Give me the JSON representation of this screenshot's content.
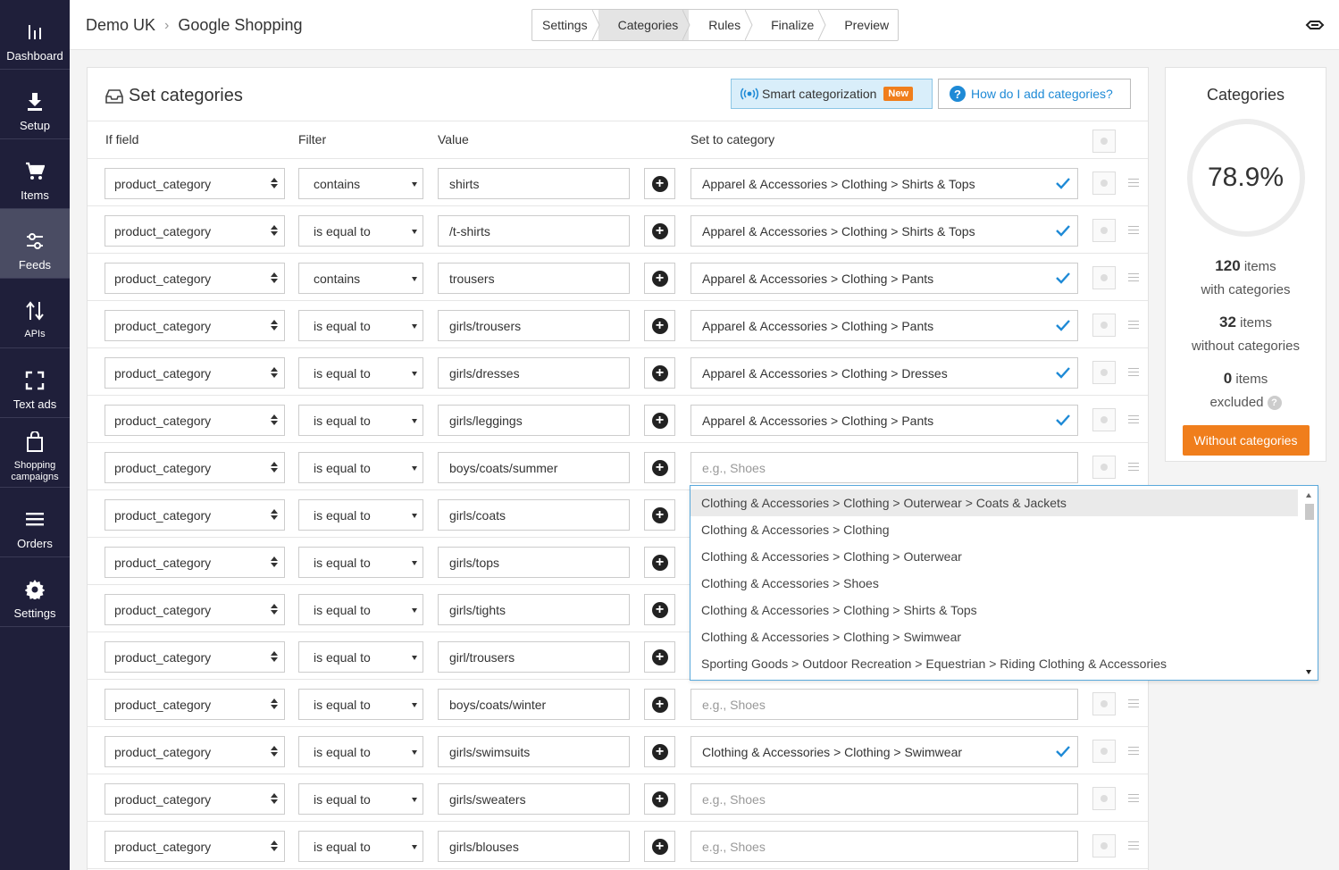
{
  "sidebar": {
    "items": [
      {
        "label": "Dashboard",
        "icon": "chart-bars-icon"
      },
      {
        "label": "Setup",
        "icon": "download-icon"
      },
      {
        "label": "Items",
        "icon": "cart-icon"
      },
      {
        "label": "Feeds",
        "icon": "sliders-icon",
        "active": true
      },
      {
        "label": "APIs",
        "icon": "swap-vertical-icon"
      },
      {
        "label": "Text ads",
        "icon": "frame-corners-icon"
      },
      {
        "label": "Shopping campaigns",
        "icon": "shopping-bag-icon"
      },
      {
        "label": "Orders",
        "icon": "list-lines-icon"
      },
      {
        "label": "Settings",
        "icon": "gear-icon"
      }
    ]
  },
  "header": {
    "breadcrumb": [
      "Demo UK",
      "Google Shopping"
    ],
    "steps": [
      {
        "label": "Settings"
      },
      {
        "label": "Categories",
        "active": true
      },
      {
        "label": "Rules"
      },
      {
        "label": "Finalize"
      },
      {
        "label": "Preview"
      }
    ]
  },
  "panel": {
    "title": "Set categories",
    "smart_label": "Smart categorization",
    "new_badge": "New",
    "help_label": "How do I add categories?",
    "columns": {
      "if_field": "If field",
      "filter": "Filter",
      "value": "Value",
      "set_to_category": "Set to category"
    },
    "placeholder": "e.g., Shoes",
    "rows": [
      {
        "field": "product_category",
        "filter": "contains",
        "value": "shirts",
        "category": "Apparel & Accessories > Clothing > Shirts & Tops"
      },
      {
        "field": "product_category",
        "filter": "is equal to",
        "value": "/t-shirts",
        "category": "Apparel & Accessories > Clothing > Shirts & Tops"
      },
      {
        "field": "product_category",
        "filter": "contains",
        "value": "trousers",
        "category": "Apparel & Accessories > Clothing > Pants"
      },
      {
        "field": "product_category",
        "filter": "is equal to",
        "value": "girls/trousers",
        "category": "Apparel & Accessories > Clothing > Pants"
      },
      {
        "field": "product_category",
        "filter": "is equal to",
        "value": "girls/dresses",
        "category": "Apparel & Accessories > Clothing > Dresses"
      },
      {
        "field": "product_category",
        "filter": "is equal to",
        "value": "girls/leggings",
        "category": "Apparel & Accessories > Clothing > Pants"
      },
      {
        "field": "product_category",
        "filter": "is equal to",
        "value": "boys/coats/summer",
        "category": ""
      },
      {
        "field": "product_category",
        "filter": "is equal to",
        "value": "girls/coats",
        "category": ""
      },
      {
        "field": "product_category",
        "filter": "is equal to",
        "value": "girls/tops",
        "category": ""
      },
      {
        "field": "product_category",
        "filter": "is equal to",
        "value": "girls/tights",
        "category": ""
      },
      {
        "field": "product_category",
        "filter": "is equal to",
        "value": "girl/trousers",
        "category": ""
      },
      {
        "field": "product_category",
        "filter": "is equal to",
        "value": "boys/coats/winter",
        "category": ""
      },
      {
        "field": "product_category",
        "filter": "is equal to",
        "value": "girls/swimsuits",
        "category": "Clothing & Accessories > Clothing > Swimwear"
      },
      {
        "field": "product_category",
        "filter": "is equal to",
        "value": "girls/sweaters",
        "category": ""
      },
      {
        "field": "product_category",
        "filter": "is equal to",
        "value": "girls/blouses",
        "category": ""
      }
    ]
  },
  "dropdown": {
    "options": [
      "Clothing & Accessories > Clothing > Outerwear > Coats & Jackets",
      "Clothing & Accessories > Clothing",
      "Clothing & Accessories > Clothing > Outerwear",
      "Clothing & Accessories > Shoes",
      "Clothing & Accessories > Clothing > Shirts & Tops",
      "Clothing & Accessories > Clothing > Swimwear",
      "Sporting Goods > Outdoor Recreation > Equestrian > Riding Clothing & Accessories"
    ]
  },
  "stats": {
    "title": "Categories",
    "percent": "78.9%",
    "with_count": "120",
    "with_unit": "items",
    "with_label": "with categories",
    "without_count": "32",
    "without_unit": "items",
    "without_label": "without categories",
    "excluded_count": "0",
    "excluded_unit": "items",
    "excluded_label": "excluded",
    "button_label": "Without categories"
  },
  "colors": {
    "sidebar": "#1f1f3a",
    "accent_orange": "#f07e1c",
    "check_blue": "#1e8ad6"
  }
}
